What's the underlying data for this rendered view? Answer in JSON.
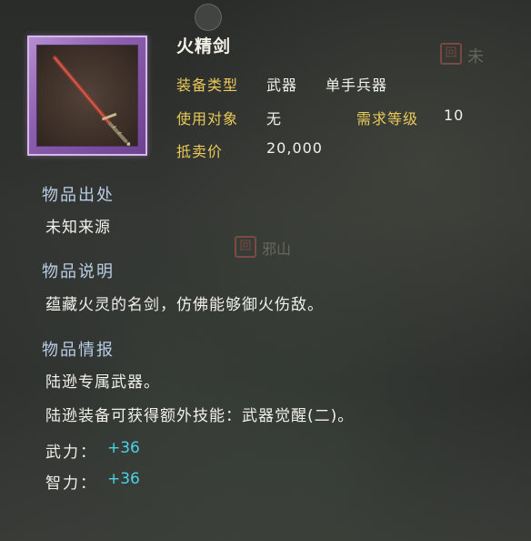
{
  "item": {
    "name": "火精剑",
    "stats": {
      "type_label": "装备类型",
      "type_value": "武器",
      "subtype_value": "单手兵器",
      "user_label": "使用对象",
      "user_value": "无",
      "level_label": "需求等级",
      "level_value": "10",
      "price_label": "抵卖价",
      "price_value": "20,000"
    },
    "sections": {
      "origin_title": "物品出处",
      "origin_text": "未知来源",
      "desc_title": "物品说明",
      "desc_text": "蕴藏火灵的名剑，仿佛能够御火伤敌。",
      "info_title": "物品情报",
      "info_line1": "陆逊专属武器。",
      "info_line2": "陆逊装备可获得额外技能：武器觉醒(二)。"
    },
    "bonuses": [
      {
        "label": "武力：",
        "value": "+36"
      },
      {
        "label": "智力：",
        "value": "+36"
      }
    ]
  },
  "map": {
    "marker_1": "回",
    "label_1": "未",
    "marker_2": "回",
    "label_2": "邪山"
  },
  "colors": {
    "frame_purple": "#8c5fae",
    "stat_label_gold": "#e9c95a",
    "section_title_blue": "#b9cde6",
    "bonus_cyan": "#4ad3e6"
  },
  "icons": {
    "item_icon": "sword-icon",
    "compass": "compass-icon"
  }
}
